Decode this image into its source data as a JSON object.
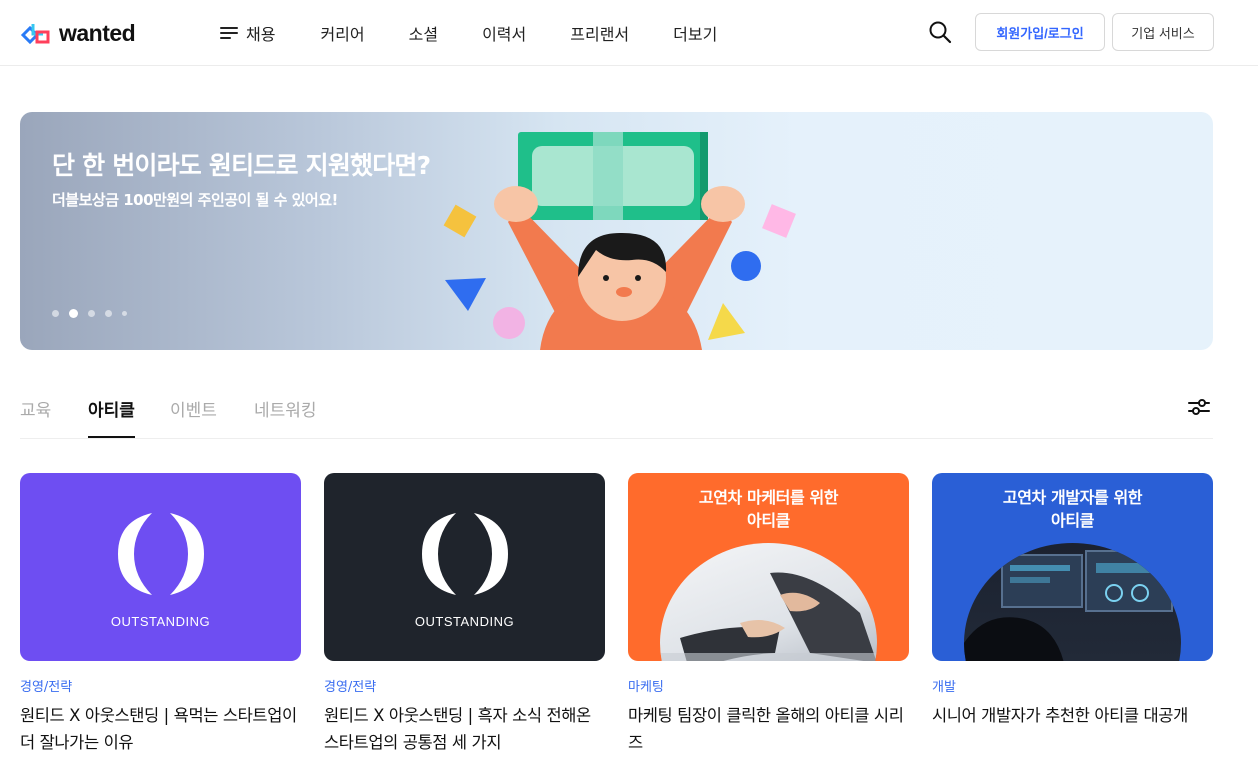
{
  "header": {
    "logo_text": "wanted",
    "nav": [
      "채용",
      "커리어",
      "소셜",
      "이력서",
      "프리랜서",
      "더보기"
    ],
    "login_label": "회원가입/로그인",
    "biz_label": "기업 서비스"
  },
  "banner": {
    "title": "단 한 번이라도 원티드로 지원했다면?",
    "subtitle": "더블보상금 100만원의 주인공이 될 수 있어요!",
    "slide_count": 5,
    "active_slide": 2
  },
  "tabs": {
    "items": [
      "교육",
      "아티클",
      "이벤트",
      "네트워킹"
    ],
    "active": "아티클"
  },
  "cards": [
    {
      "category": "경영/전략",
      "title": "원티드 X 아웃스탠딩 | 욕먹는 스타트업이 더 잘나가는 이유",
      "thumb_text": "OUTSTANDING",
      "thumb_color": "#6e4ef2"
    },
    {
      "category": "경영/전략",
      "title": "원티드 X 아웃스탠딩 | 흑자 소식 전해온 스타트업의 공통점 세 가지",
      "thumb_text": "OUTSTANDING",
      "thumb_color": "#1f242c"
    },
    {
      "category": "마케팅",
      "title": "마케팅 팀장이 클릭한 올해의 아티클 시리즈",
      "thumb_line1": "고연차 마케터를 위한",
      "thumb_line2": "아티클",
      "thumb_color": "#ff6b2c"
    },
    {
      "category": "개발",
      "title": "시니어 개발자가 추천한 아티클 대공개",
      "thumb_line1": "고연차 개발자를 위한",
      "thumb_line2": "아티클",
      "thumb_color": "#2a5fd6"
    }
  ],
  "colors": {
    "accent": "#3366ff",
    "category": "#3a6df0"
  },
  "icons": [
    "menu-icon",
    "search-icon",
    "filter-icon"
  ]
}
